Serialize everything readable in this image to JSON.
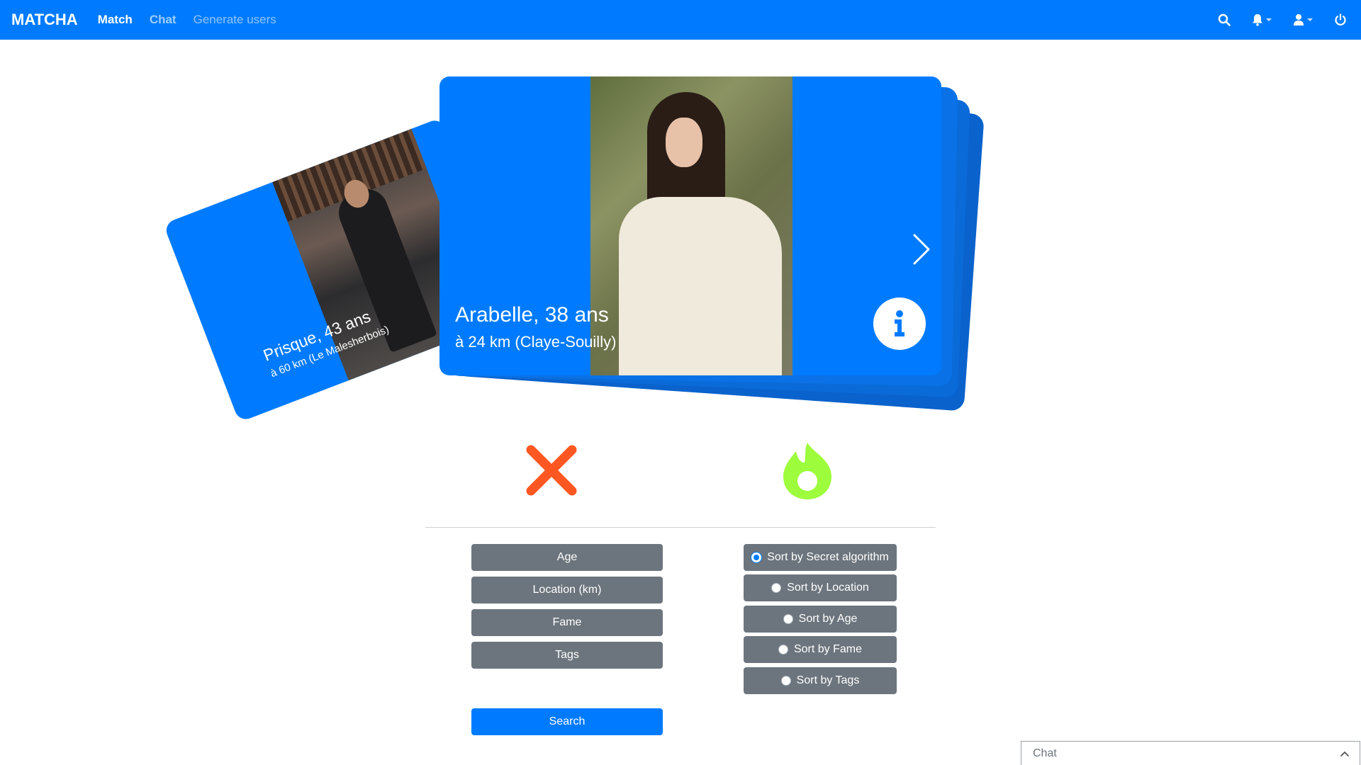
{
  "navbar": {
    "brand": "MATCHA",
    "links": [
      {
        "label": "Match"
      },
      {
        "label": "Chat"
      },
      {
        "label": "Generate users"
      }
    ],
    "icons": [
      "search-icon",
      "bell-icon",
      "user-icon",
      "power-icon"
    ]
  },
  "cards": {
    "previous": {
      "name": "Prisque, 43 ans",
      "distance": "à 60 km (Le Malesherbois)"
    },
    "current": {
      "name": "Arabelle, 38 ans",
      "distance": "à 24 km (Claye-Souilly)"
    }
  },
  "actions": {
    "dislike_icon": "close-x-icon",
    "like_icon": "flame-icon",
    "dislike_color": "#ff5722",
    "like_color": "#9dfc3c"
  },
  "filters": [
    "Age",
    "Location (km)",
    "Fame",
    "Tags"
  ],
  "sort": {
    "options": [
      {
        "label": "Sort by Secret algorithm",
        "checked": true
      },
      {
        "label": "Sort by Location",
        "checked": false
      },
      {
        "label": "Sort by Age",
        "checked": false
      },
      {
        "label": "Sort by Fame",
        "checked": false
      },
      {
        "label": "Sort by Tags",
        "checked": false
      }
    ]
  },
  "search_label": "Search",
  "chat_dock": {
    "label": "Chat"
  },
  "colors": {
    "primary": "#007bff",
    "secondary": "#6c757d"
  }
}
